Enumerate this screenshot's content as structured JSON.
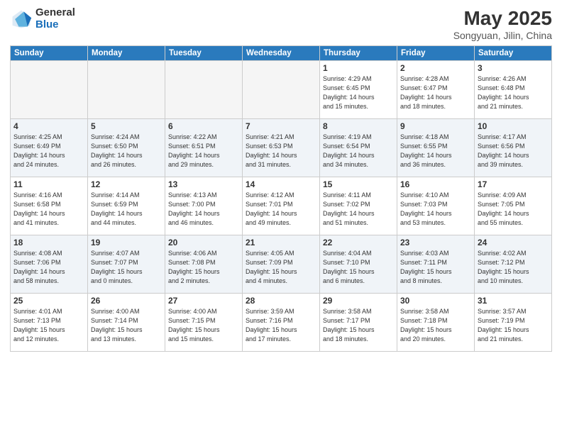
{
  "header": {
    "logo_general": "General",
    "logo_blue": "Blue",
    "title": "May 2025",
    "location": "Songyuan, Jilin, China"
  },
  "days_of_week": [
    "Sunday",
    "Monday",
    "Tuesday",
    "Wednesday",
    "Thursday",
    "Friday",
    "Saturday"
  ],
  "weeks": [
    [
      {
        "day": "",
        "info": ""
      },
      {
        "day": "",
        "info": ""
      },
      {
        "day": "",
        "info": ""
      },
      {
        "day": "",
        "info": ""
      },
      {
        "day": "1",
        "info": "Sunrise: 4:29 AM\nSunset: 6:45 PM\nDaylight: 14 hours\nand 15 minutes."
      },
      {
        "day": "2",
        "info": "Sunrise: 4:28 AM\nSunset: 6:47 PM\nDaylight: 14 hours\nand 18 minutes."
      },
      {
        "day": "3",
        "info": "Sunrise: 4:26 AM\nSunset: 6:48 PM\nDaylight: 14 hours\nand 21 minutes."
      }
    ],
    [
      {
        "day": "4",
        "info": "Sunrise: 4:25 AM\nSunset: 6:49 PM\nDaylight: 14 hours\nand 24 minutes."
      },
      {
        "day": "5",
        "info": "Sunrise: 4:24 AM\nSunset: 6:50 PM\nDaylight: 14 hours\nand 26 minutes."
      },
      {
        "day": "6",
        "info": "Sunrise: 4:22 AM\nSunset: 6:51 PM\nDaylight: 14 hours\nand 29 minutes."
      },
      {
        "day": "7",
        "info": "Sunrise: 4:21 AM\nSunset: 6:53 PM\nDaylight: 14 hours\nand 31 minutes."
      },
      {
        "day": "8",
        "info": "Sunrise: 4:19 AM\nSunset: 6:54 PM\nDaylight: 14 hours\nand 34 minutes."
      },
      {
        "day": "9",
        "info": "Sunrise: 4:18 AM\nSunset: 6:55 PM\nDaylight: 14 hours\nand 36 minutes."
      },
      {
        "day": "10",
        "info": "Sunrise: 4:17 AM\nSunset: 6:56 PM\nDaylight: 14 hours\nand 39 minutes."
      }
    ],
    [
      {
        "day": "11",
        "info": "Sunrise: 4:16 AM\nSunset: 6:58 PM\nDaylight: 14 hours\nand 41 minutes."
      },
      {
        "day": "12",
        "info": "Sunrise: 4:14 AM\nSunset: 6:59 PM\nDaylight: 14 hours\nand 44 minutes."
      },
      {
        "day": "13",
        "info": "Sunrise: 4:13 AM\nSunset: 7:00 PM\nDaylight: 14 hours\nand 46 minutes."
      },
      {
        "day": "14",
        "info": "Sunrise: 4:12 AM\nSunset: 7:01 PM\nDaylight: 14 hours\nand 49 minutes."
      },
      {
        "day": "15",
        "info": "Sunrise: 4:11 AM\nSunset: 7:02 PM\nDaylight: 14 hours\nand 51 minutes."
      },
      {
        "day": "16",
        "info": "Sunrise: 4:10 AM\nSunset: 7:03 PM\nDaylight: 14 hours\nand 53 minutes."
      },
      {
        "day": "17",
        "info": "Sunrise: 4:09 AM\nSunset: 7:05 PM\nDaylight: 14 hours\nand 55 minutes."
      }
    ],
    [
      {
        "day": "18",
        "info": "Sunrise: 4:08 AM\nSunset: 7:06 PM\nDaylight: 14 hours\nand 58 minutes."
      },
      {
        "day": "19",
        "info": "Sunrise: 4:07 AM\nSunset: 7:07 PM\nDaylight: 15 hours\nand 0 minutes."
      },
      {
        "day": "20",
        "info": "Sunrise: 4:06 AM\nSunset: 7:08 PM\nDaylight: 15 hours\nand 2 minutes."
      },
      {
        "day": "21",
        "info": "Sunrise: 4:05 AM\nSunset: 7:09 PM\nDaylight: 15 hours\nand 4 minutes."
      },
      {
        "day": "22",
        "info": "Sunrise: 4:04 AM\nSunset: 7:10 PM\nDaylight: 15 hours\nand 6 minutes."
      },
      {
        "day": "23",
        "info": "Sunrise: 4:03 AM\nSunset: 7:11 PM\nDaylight: 15 hours\nand 8 minutes."
      },
      {
        "day": "24",
        "info": "Sunrise: 4:02 AM\nSunset: 7:12 PM\nDaylight: 15 hours\nand 10 minutes."
      }
    ],
    [
      {
        "day": "25",
        "info": "Sunrise: 4:01 AM\nSunset: 7:13 PM\nDaylight: 15 hours\nand 12 minutes."
      },
      {
        "day": "26",
        "info": "Sunrise: 4:00 AM\nSunset: 7:14 PM\nDaylight: 15 hours\nand 13 minutes."
      },
      {
        "day": "27",
        "info": "Sunrise: 4:00 AM\nSunset: 7:15 PM\nDaylight: 15 hours\nand 15 minutes."
      },
      {
        "day": "28",
        "info": "Sunrise: 3:59 AM\nSunset: 7:16 PM\nDaylight: 15 hours\nand 17 minutes."
      },
      {
        "day": "29",
        "info": "Sunrise: 3:58 AM\nSunset: 7:17 PM\nDaylight: 15 hours\nand 18 minutes."
      },
      {
        "day": "30",
        "info": "Sunrise: 3:58 AM\nSunset: 7:18 PM\nDaylight: 15 hours\nand 20 minutes."
      },
      {
        "day": "31",
        "info": "Sunrise: 3:57 AM\nSunset: 7:19 PM\nDaylight: 15 hours\nand 21 minutes."
      }
    ]
  ]
}
